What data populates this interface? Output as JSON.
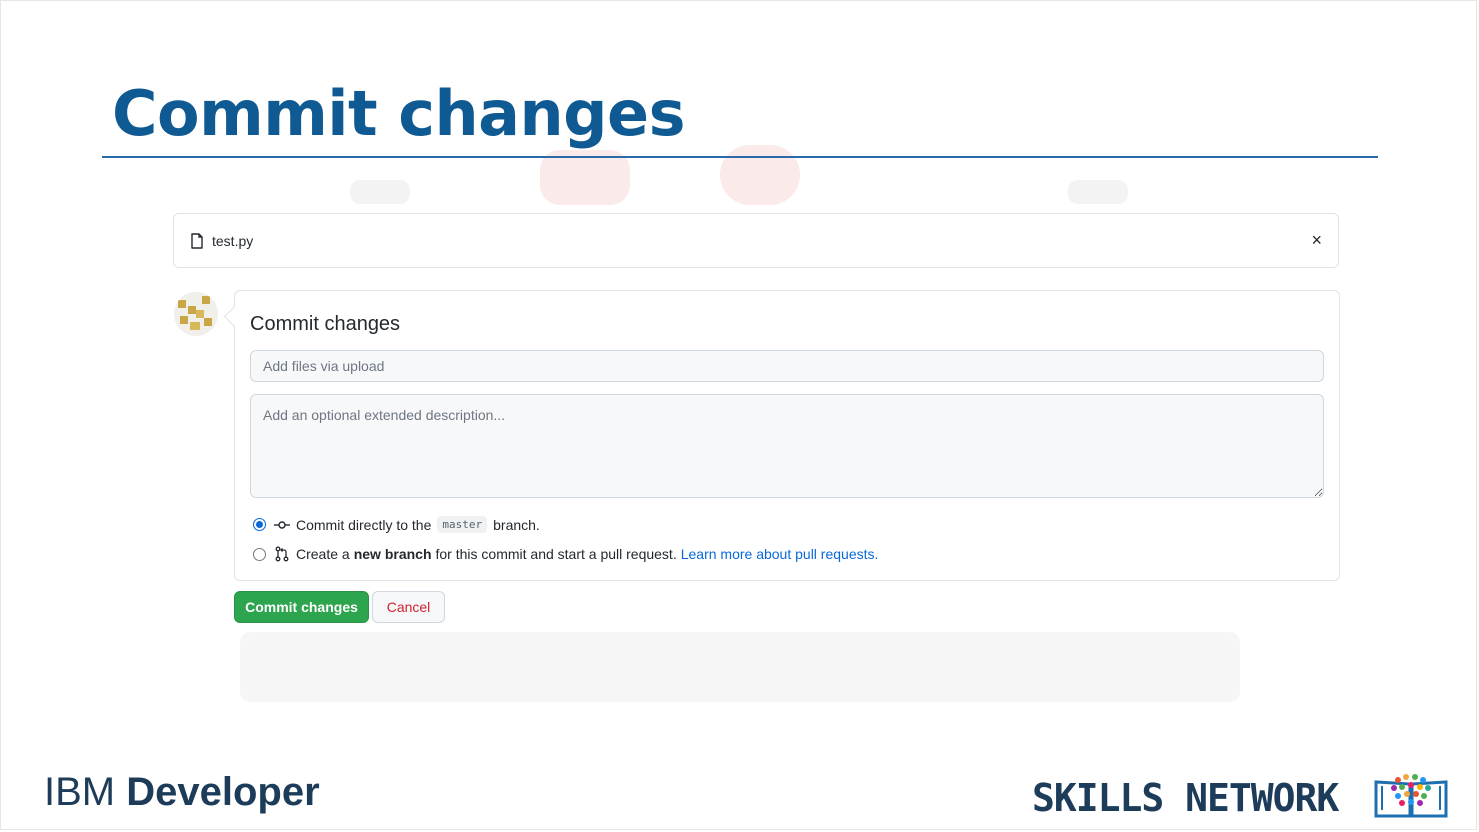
{
  "slide": {
    "title": "Commit changes"
  },
  "file_bar": {
    "file_icon": "file-icon",
    "file_name": "test.py",
    "close_label": "×"
  },
  "commit_form": {
    "heading": "Commit changes",
    "summary_placeholder": "Add files via upload",
    "description_placeholder": "Add an optional extended description...",
    "option_direct": {
      "icon": "git-commit-icon",
      "text_before": "Commit directly to the",
      "branch": "master",
      "text_after": "branch.",
      "selected": true
    },
    "option_new_branch": {
      "icon": "git-pull-request-icon",
      "text_before": "Create a",
      "bold": "new branch",
      "text_after": "for this commit and start a pull request.",
      "link": "Learn more about pull requests.",
      "selected": false
    }
  },
  "buttons": {
    "commit": "Commit changes",
    "cancel": "Cancel"
  },
  "footer": {
    "brand_left_part1": "IBM",
    "brand_left_part2": "Developer",
    "brand_right": "SKILLS NETWORK",
    "logo_icon": "book-icon"
  },
  "colors": {
    "title": "#0f5a93",
    "commit_button": "#2da44e",
    "cancel_text": "#cf222e",
    "link": "#0969da",
    "brand": "#1d3c5a"
  }
}
